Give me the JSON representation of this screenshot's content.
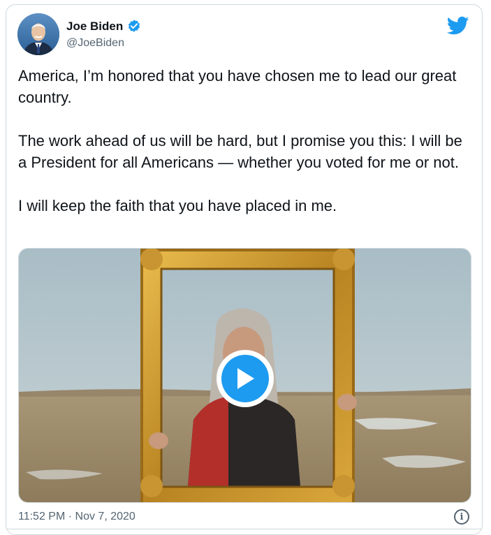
{
  "author": {
    "display_name": "Joe Biden",
    "handle": "@JoeBiden",
    "verified_icon": "verified-badge-icon",
    "avatar_icon": "profile-photo"
  },
  "brand": {
    "logo_icon": "twitter-bird-icon",
    "accent": "#1d9bf0"
  },
  "tweet": {
    "paragraphs": [
      "America, I’m honored that you have chosen me to lead our great country.",
      "The work ahead of us will be hard, but I promise you this: I will be a President for all Americans — whether you voted for me or not.",
      "I will keep the faith that you have placed in me."
    ],
    "timestamp": "11:52 PM · Nov 7, 2020"
  },
  "media": {
    "type": "video",
    "play_icon": "play-icon"
  },
  "actions": {
    "info_icon": "info-icon",
    "info_glyph": "i"
  }
}
